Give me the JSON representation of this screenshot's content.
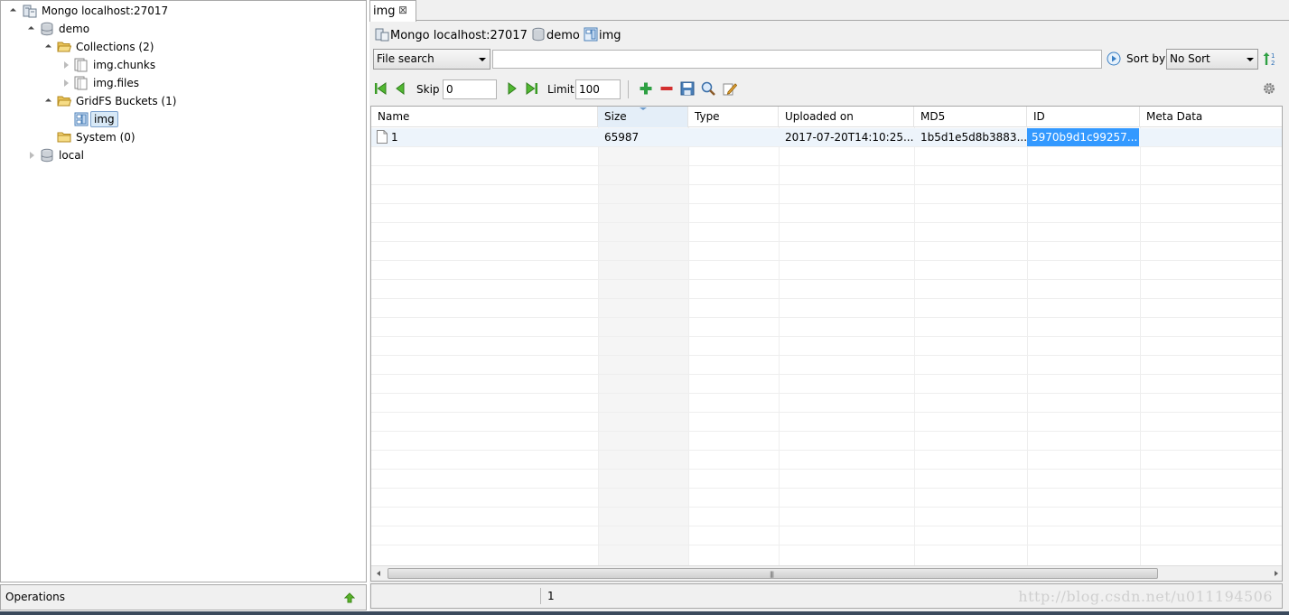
{
  "tree": {
    "connection": "Mongo localhost:27017",
    "database": "demo",
    "collections": "Collections (2)",
    "collection_items": [
      "img.chunks",
      "img.files"
    ],
    "gridfs": "GridFS Buckets (1)",
    "gridfs_items": [
      "img"
    ],
    "system": "System (0)",
    "other_db": "local"
  },
  "operations": {
    "label": "Operations"
  },
  "tab": {
    "label": "img",
    "close": "⊠"
  },
  "breadcrumb": {
    "connection": "Mongo localhost:27017",
    "database": "demo",
    "bucket": "img"
  },
  "search": {
    "type": "File search",
    "value": "",
    "sort_label": "Sort by",
    "sort_value": "No Sort"
  },
  "paging": {
    "skip_label": "Skip",
    "skip": "0",
    "limit_label": "Limit",
    "limit": "100"
  },
  "grid": {
    "columns": [
      "Name",
      "Size",
      "Type",
      "Uploaded on",
      "MD5",
      "ID",
      "Meta Data"
    ],
    "sorted_column": "Size",
    "rows": [
      {
        "name": "1",
        "size": "65987",
        "type": "",
        "uploaded": "2017-07-20T14:10:25....",
        "md5": "1b5d1e5d8b3883...",
        "id": "5970b9d1c99257...",
        "meta": ""
      }
    ]
  },
  "status": {
    "count": "1",
    "watermark": "http://blog.csdn.net/u011194506"
  },
  "colors": {
    "selection": "#3399ff",
    "selected_row": "#edf4fb",
    "tree_selection": "#d8e9f7",
    "accent_green": "#2ea043",
    "accent_red": "#d32f2f"
  },
  "icons": {
    "tree": [
      "server-icon",
      "database-icon",
      "folder-icon",
      "collection-icon",
      "gridfs-bucket-icon"
    ],
    "toolbar": [
      "first-page-icon",
      "prev-page-icon",
      "next-page-icon",
      "last-page-icon",
      "add-icon",
      "remove-icon",
      "save-icon",
      "search-icon",
      "edit-icon",
      "settings-icon"
    ]
  }
}
